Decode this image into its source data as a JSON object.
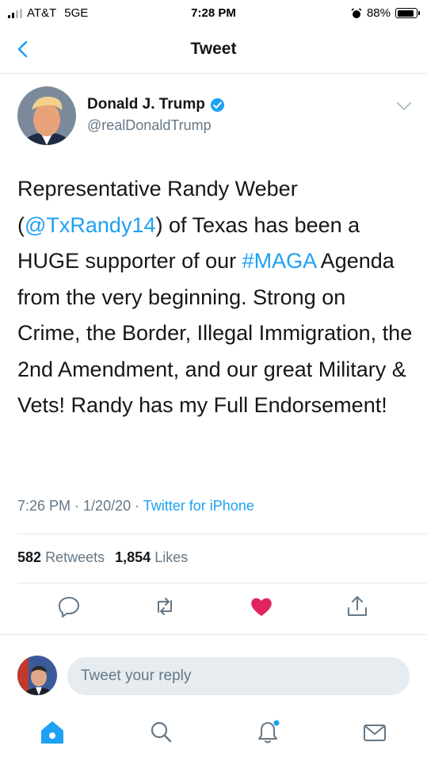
{
  "status": {
    "carrier": "AT&T",
    "network": "5GE",
    "time": "7:28 PM",
    "battery": "88%"
  },
  "header": {
    "title": "Tweet"
  },
  "author": {
    "name": "Donald J. Trump",
    "handle": "@realDonaldTrump",
    "verified": true
  },
  "tweet": {
    "part1": "Representative Randy Weber (",
    "mention": "@TxRandy14",
    "part2": ") of Texas has been a HUGE supporter of our ",
    "hashtag": "#MAGA",
    "part3": " Agenda from the very beginning. Strong on Crime, the Border, Illegal Immigration, the 2nd Amendment, and our great Military & Vets! Randy has my Full Endorsement!"
  },
  "meta": {
    "time": "7:26 PM",
    "sep1": " · ",
    "date": "1/20/20",
    "sep2": " · ",
    "source": "Twitter for iPhone"
  },
  "stats": {
    "retweets_count": "582",
    "retweets_label": "Retweets",
    "likes_count": "1,854",
    "likes_label": "Likes"
  },
  "reply": {
    "placeholder": "Tweet your reply"
  },
  "colors": {
    "accent": "#1da1f2",
    "like": "#e0245e",
    "muted": "#657786"
  },
  "icons": [
    "back-chevron-icon",
    "verified-badge-icon",
    "caret-down-icon",
    "reply-icon",
    "retweet-icon",
    "like-heart-icon",
    "share-icon",
    "home-icon",
    "search-icon",
    "notifications-icon",
    "messages-icon"
  ]
}
